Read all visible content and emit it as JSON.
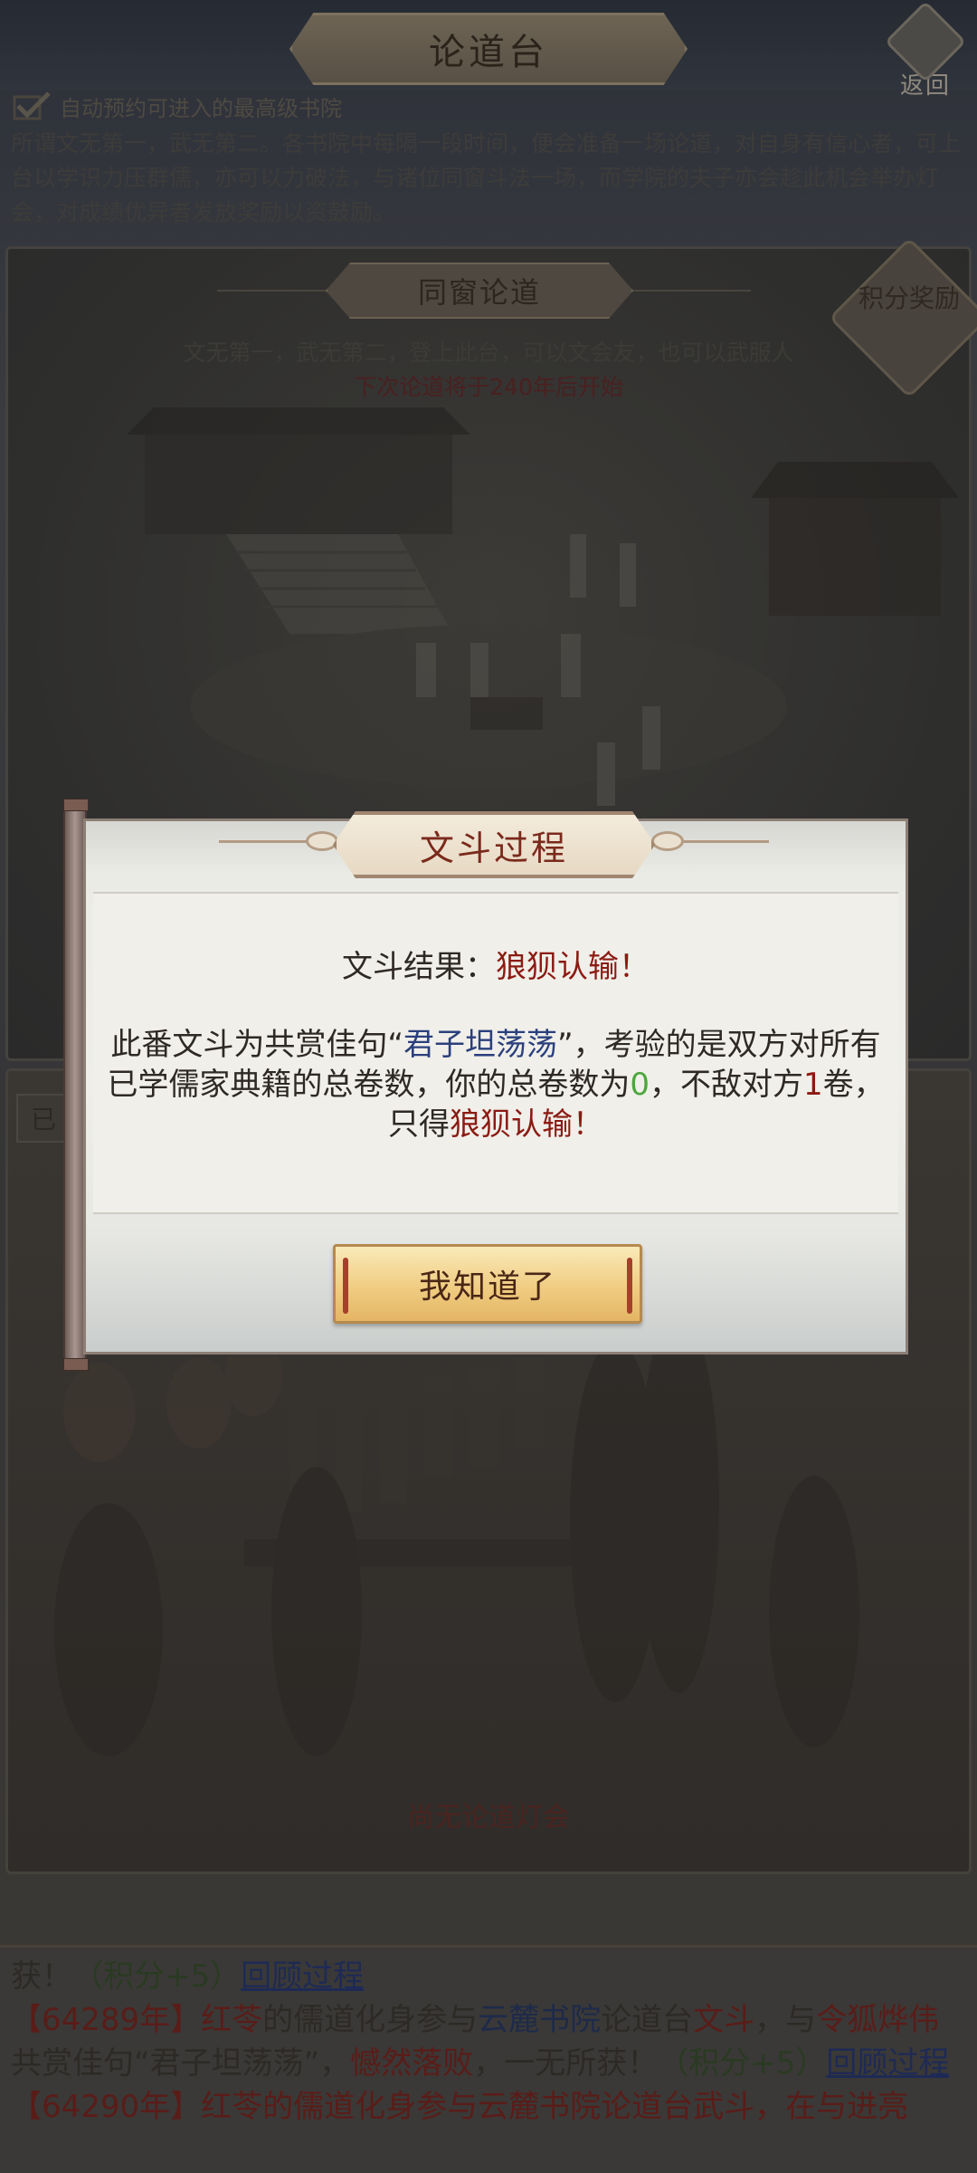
{
  "header": {
    "title": "论道台",
    "back_label": "返回",
    "auto_signup_label": "自动预约可进入的最高级书院"
  },
  "intro": "所谓文无第一，武无第二。各书院中每隔一段时间，便会准备一场论道，对自身有信心者，可上台以学识力压群儒，亦可以力破法，与诸位同窗斗法一场，而学院的夫子亦会趁此机会举办灯会，对成绩优异者发放奖励以资鼓励。",
  "panel": {
    "title": "同窗论道",
    "reward_label": "积分奖励",
    "slogan": "文无第一，武无第二，登上此台，可以文会友，也可以武服人",
    "next_debate": "下次论道将于240年后开始"
  },
  "lower_panel": {
    "status_tag": "已",
    "empty_lantern": "尚无论道灯会"
  },
  "log": {
    "line1_prefix": "获！",
    "line1_score": "（积分+5）",
    "line1_link": "回顾过程",
    "line2_year": "【64289年】",
    "line2_name": "红苓",
    "line2_text1": "的儒道化身参与",
    "line2_academy": "云麓书院",
    "line2_text2": "论道台",
    "line2_event": "文斗",
    "line2_text3": "，与",
    "line2_opponent": "令狐烨伟",
    "line2_text4": "共赏佳句“君子坦荡荡”，",
    "line2_result": "憾然落败",
    "line2_text5": "，一无所获！",
    "line2_score": "（积分+5）",
    "line2_link": "回顾过程",
    "line3": "【64290年】红苓的儒道化身参与云麓书院论道台武斗，在与进亮"
  },
  "dialog": {
    "title": "文斗过程",
    "result_label": "文斗结果：",
    "result_value": "狼狈认输！",
    "detail_part1": "此番文斗为共赏佳句“",
    "detail_quote": "君子坦荡荡",
    "detail_part2": "”，考验的是双方对所有已学儒家典籍的总卷数，你的总卷数为",
    "my_volumes": "0",
    "detail_part3": "，不敌对方",
    "opponent_volumes": "1",
    "detail_part4": "卷，只得",
    "detail_outcome": "狼狈认输！",
    "confirm_label": "我知道了"
  }
}
